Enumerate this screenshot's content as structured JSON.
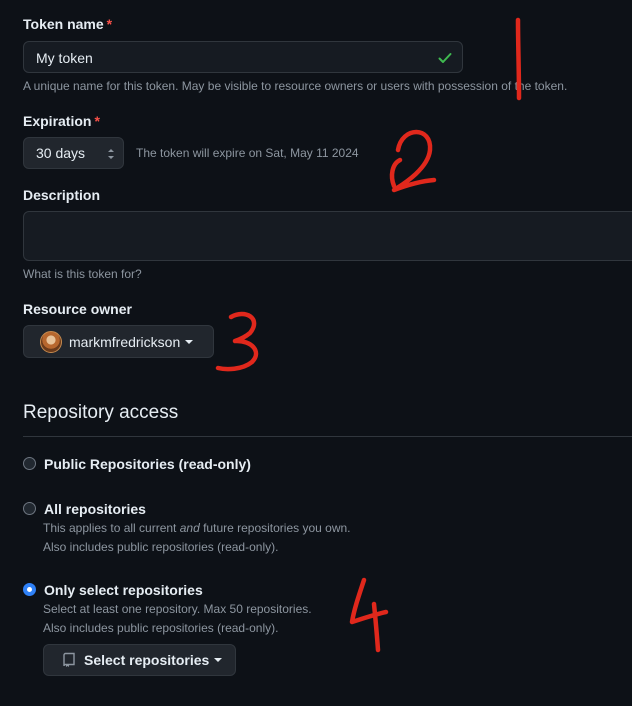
{
  "token_name": {
    "label": "Token name",
    "required_mark": "*",
    "value": "My token",
    "hint": "A unique name for this token. May be visible to resource owners or users with possession of the token."
  },
  "expiration": {
    "label": "Expiration",
    "required_mark": "*",
    "selected": "30 days",
    "note": "The token will expire on Sat, May 11 2024"
  },
  "description": {
    "label": "Description",
    "value": "",
    "hint": "What is this token for?"
  },
  "resource_owner": {
    "label": "Resource owner",
    "selected": "markmfredrickson"
  },
  "repository_access": {
    "heading": "Repository access",
    "options": [
      {
        "label": "Public Repositories (read-only)",
        "checked": false,
        "desc1": "",
        "desc2": ""
      },
      {
        "label": "All repositories",
        "checked": false,
        "desc1_pre": "This applies to all current ",
        "desc1_em": "and",
        "desc1_post": " future repositories you own.",
        "desc2": "Also includes public repositories (read-only)."
      },
      {
        "label": "Only select repositories",
        "checked": true,
        "desc1": "Select at least one repository. Max 50 repositories.",
        "desc2": "Also includes public repositories (read-only)."
      }
    ],
    "select_button": "Select repositories"
  },
  "colors": {
    "background": "#0d1117",
    "accent": "#2f81f7",
    "success": "#3fb950",
    "danger": "#f85149",
    "annotation": "#e0281c"
  },
  "icons": {
    "valid": "check-icon",
    "stepper": "up-down-chevron-icon",
    "repo": "repo-icon",
    "dropdown": "caret-down-icon"
  }
}
